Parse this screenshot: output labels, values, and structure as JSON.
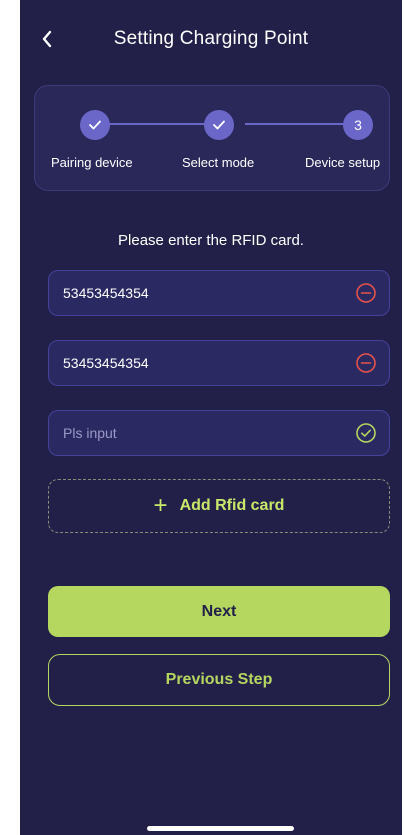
{
  "header": {
    "title": "Setting Charging Point",
    "back_icon": "chevron-left-icon"
  },
  "stepper": {
    "steps": [
      {
        "label": "Pairing device",
        "state": "done",
        "marker": "✓"
      },
      {
        "label": "Select mode",
        "state": "done",
        "marker": "✓"
      },
      {
        "label": "Device setup",
        "state": "current",
        "marker": "3"
      }
    ]
  },
  "rfid": {
    "prompt": "Please enter the RFID card.",
    "cards": [
      {
        "value": "53453454354",
        "icon": "remove-circle-icon"
      },
      {
        "value": "53453454354",
        "icon": "remove-circle-icon"
      }
    ],
    "new_card": {
      "value": "",
      "placeholder": "Pls input",
      "icon": "confirm-check-icon"
    },
    "add_label": "Add Rfid card",
    "add_icon": "plus-icon"
  },
  "actions": {
    "next_label": "Next",
    "previous_label": "Previous Step"
  },
  "colors": {
    "background": "#222049",
    "accent": "#b5d65f",
    "step": "#6a67c9",
    "remove": "#e5534b",
    "confirm": "#b5d65f"
  }
}
